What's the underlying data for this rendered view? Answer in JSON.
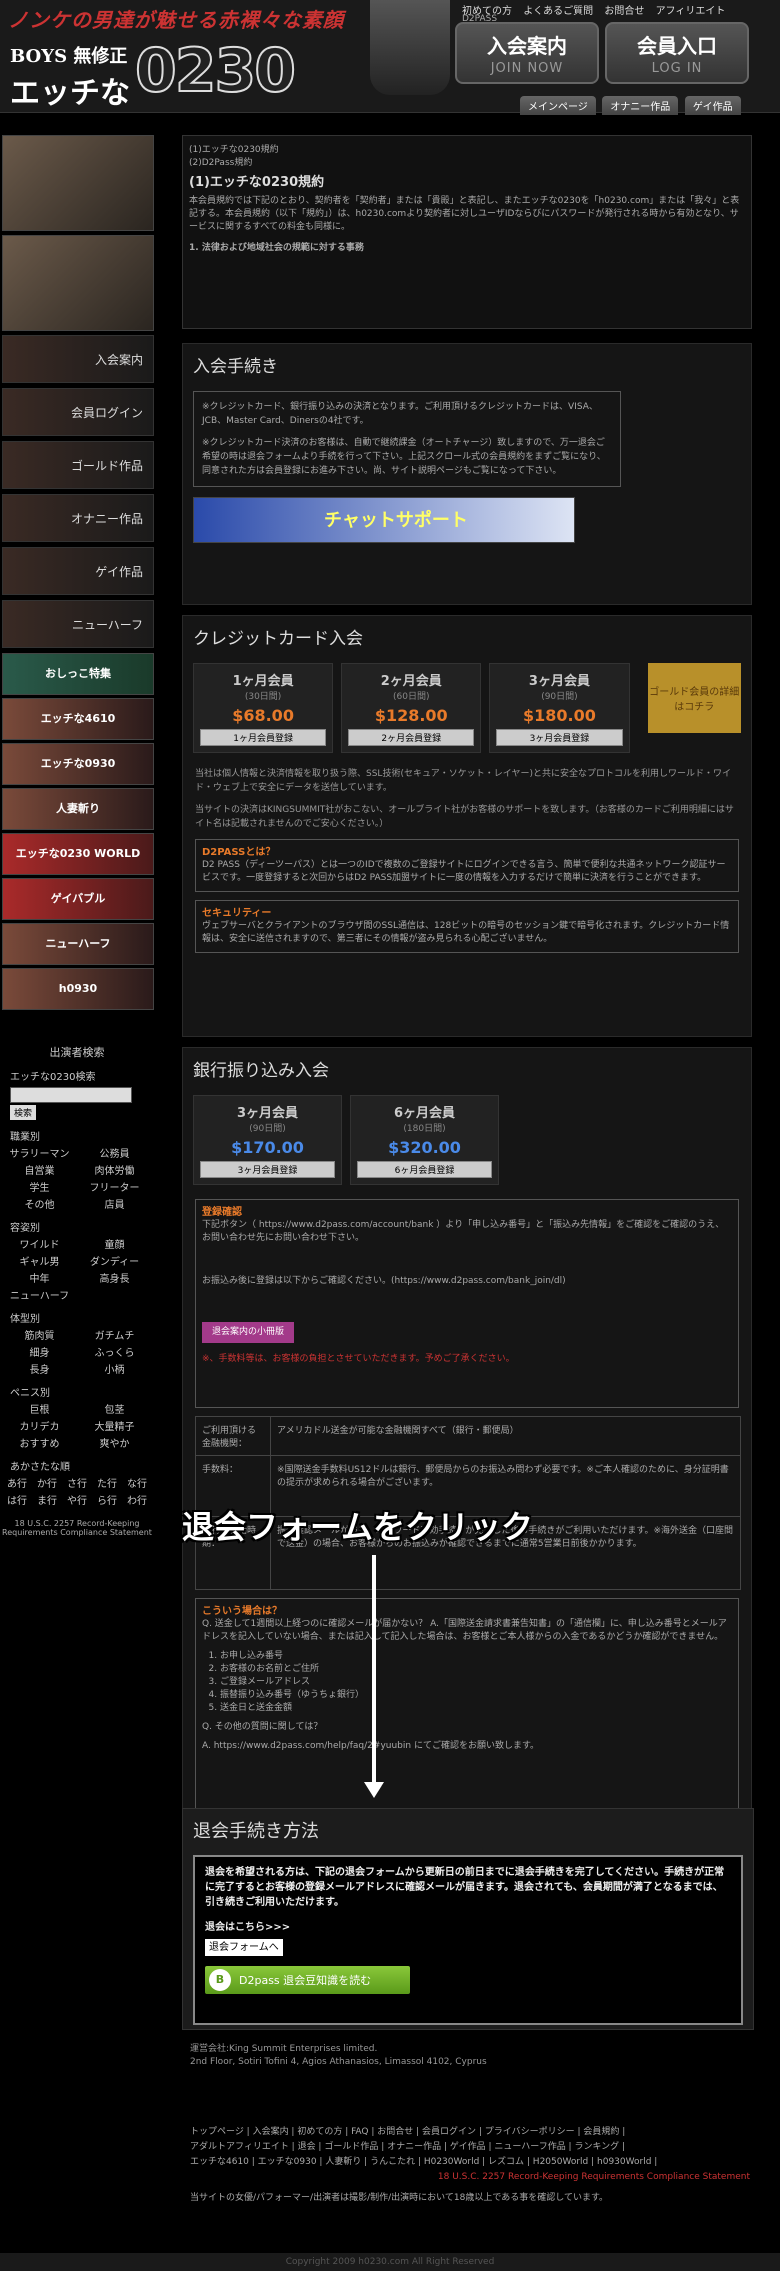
{
  "header": {
    "tagline": "ノンケの男達が魅せる赤裸々な素顔",
    "logo_sub": "BOYS 無修正",
    "logo_main": "エッチな",
    "logo_num": "0230",
    "top_links": [
      "初めての方",
      "よくあるご質問",
      "お問合せ",
      "アフィリエイト"
    ],
    "d2pass_label": "D2PASS",
    "join_label": "入会案内",
    "join_sub": "JOIN NOW",
    "login_label": "会員入口",
    "login_sub": "LOG IN",
    "tabs": [
      "メインページ",
      "オナニー作品",
      "ゲイ作品"
    ]
  },
  "sidebar": {
    "nav": [
      "入会案内",
      "会員ログイン",
      "ゴールド作品",
      "オナニー作品",
      "ゲイ作品",
      "ニューハーフ"
    ],
    "banners": [
      "おしっこ特集",
      "エッチな4610",
      "エッチな0930",
      "人妻斬り",
      "エッチな0230 WORLD",
      "ゲイバブル",
      "ニューハーフ",
      "h0930"
    ],
    "search_head": "出演者検索",
    "search_label": "エッチな0230検索",
    "search_button": "検索",
    "job_head": "職業別",
    "jobs": [
      [
        "サラリーマン",
        "公務員"
      ],
      [
        "自営業",
        "肉体労働"
      ],
      [
        "学生",
        "フリーター"
      ],
      [
        "その他",
        "店員"
      ]
    ],
    "type_head": "容姿別",
    "types": [
      [
        "ワイルド",
        "童顔"
      ],
      [
        "ギャル男",
        "ダンディー"
      ],
      [
        "中年",
        "高身長"
      ],
      [
        "ニューハーフ",
        ""
      ]
    ],
    "body_head": "体型別",
    "bodies": [
      [
        "筋肉質",
        "ガチムチ"
      ],
      [
        "細身",
        "ふっくら"
      ],
      [
        "長身",
        "小柄"
      ]
    ],
    "penis_head": "ペニス別",
    "penis": [
      [
        "巨根",
        "包茎"
      ],
      [
        "カリデカ",
        "大量精子"
      ],
      [
        "おすすめ",
        "爽やか"
      ]
    ],
    "kana_head": "あかさたな順",
    "kana": [
      [
        "あ行",
        "か行",
        "さ行",
        "た行",
        "な行"
      ],
      [
        "は行",
        "ま行",
        "や行",
        "ら行",
        "わ行"
      ]
    ],
    "legal": "18 U.S.C. 2257 Record-Keeping Requirements Compliance Statement"
  },
  "terms": {
    "line1": "(1)エッチな0230規約",
    "line2": "(2)D2Pass規約",
    "heading": "(1)エッチな0230規約",
    "body": "本会員規約では下記のとおり、契約者を「契約者」または「貴殿」と表記し、またエッチな0230を「h0230.com」または「我々」と表記する。本会員規約（以下「規約」）は、h0230.comより契約者に対しユーザIDならびにパスワードが発行される時から有効となり、サービスに関するすべての料金も同様に。",
    "section": "1. 法律および地域社会の規範に対する事務"
  },
  "join": {
    "title": "入会手続き",
    "box1": "※クレジットカード、銀行振り込みの決済となります。ご利用頂けるクレジットカードは、VISA、JCB、Master Card、Dinersの4社です。",
    "box2": "※クレジットカード決済のお客様は、自動で継続課金（オートチャージ）致しますので、万一退会ご希望の時は退会フォームより手続を行って下さい。上記スクロール式の会員規約をまずご覧になり、同意された方は会員登録にお進み下さい。尚、サイト説明ページもご覧になって下さい。",
    "chat_label": "チャットサポート"
  },
  "credit": {
    "title": "クレジットカード入会",
    "plans": [
      {
        "name": "1ヶ月会員",
        "days": "(30日間)",
        "price": "$68.00",
        "btn": "1ヶ月会員登録"
      },
      {
        "name": "2ヶ月会員",
        "days": "(60日間)",
        "price": "$128.00",
        "btn": "2ヶ月会員登録"
      },
      {
        "name": "3ヶ月会員",
        "days": "(90日間)",
        "price": "$180.00",
        "btn": "3ヶ月会員登録"
      }
    ],
    "gold": "ゴールド会員の詳細はコチラ",
    "note1": "当社は個人情報と決済情報を取り扱う際、SSL技術(セキュア・ソケット・レイヤー)と共に安全なプロトコルを利用しワールド・ワイド・ウェブ上で安全にデータを送信しています。",
    "note2": "当サイトの決済はKINGSUMMIT社がおこない、オールブライト社がお客様のサポートを致します。（お客様のカードご利用明細にはサイト名は記載されませんのでご安心ください。）",
    "d2_head": "D2PASSとは？",
    "d2_body": "D2 PASS（ディーツーパス）とは一つのIDで複数のご登録サイトにログインできる言う、簡単で便利な共通ネットワーク認証サービスです。一度登録すると次回からはD2 PASS加盟サイトに一度の情報を入力するだけで簡単に決済を行うことができます。",
    "sec_head": "セキュリティー",
    "sec_body": "ヴェブサーバとクライアントのブラウザ間のSSL通信は、128ビットの暗号のセッション鍵で暗号化されます。クレジットカード情報は、安全に送信されますので、第三者にその情報が盗み見られる心配ございません。"
  },
  "bank": {
    "title": "銀行振り込み入会",
    "plans": [
      {
        "name": "3ヶ月会員",
        "days": "(90日間)",
        "price": "$170.00",
        "btn": "3ヶ月会員登録"
      },
      {
        "name": "6ヶ月会員",
        "days": "(180日間)",
        "price": "$320.00",
        "btn": "6ヶ月会員登録"
      }
    ],
    "reg_head": "登録確認",
    "reg_body": "下記ボタン（ https://www.d2pass.com/account/bank ）より「申し込み番号」と「振込み先情報」をご確認をご確認のうえ、お問い合わせ先にお問い合わせ下さい。",
    "link_note": "お振込み後に登録は以下からご確認ください。(https://www.d2pass.com/bank_join/dl)",
    "small_btn": "退会案内の小冊版",
    "warn": "※、手数料等は、お客様の負担とさせていただきます。予めご了承ください。",
    "table": [
      [
        "ご利用頂ける金融機関：",
        "アメリカドル送金が可能な金融機関すべて（銀行・郵便局）"
      ],
      [
        "手数料：",
        "※国際送金手数料US12ドルは銀行、郵便局からのお振込み問わず必要です。※ご本人確認のために、身分証明書の提示が求められる場合がございます。"
      ],
      [
        "ご利用開始時期：",
        "振込確認メールが届き、パスワード有効手続きが完了した後お手続きがご利用いただけます。※海外送金（口座間で送金）の場合、お客様からのお振込みが確認できるまでに通常5営業日前後かかります。"
      ]
    ],
    "faq_q": "こういう場合は？",
    "faq_body": "Q. 送金して1週間以上経つのに確認メールが届かない？ A.「国際送金請求書兼告知書」の「通信欄」に、申し込み番号とメールアドレスを記入していない場合、または記入して記入した場合は、お客様とご本人様からの入金であるかどうか確認ができません。",
    "faq_list": [
      "お申し込み番号",
      "お客様のお名前とご住所",
      "ご登録メールアドレス",
      "振替振り込み番号（ゆうちょ銀行）",
      "送金日と送金金額"
    ],
    "faq_q2": "Q. その他の質問に関しては？",
    "faq_a2": "A. https://www.d2pass.com/help/faq/2#yuubin にてご確認をお願い致します。"
  },
  "annotation": "退会フォームをクリック",
  "withdraw": {
    "title": "退会手続き方法",
    "body": "退会を希望される方は、下記の退会フォームから更新日の前日までに退会手続きを完了してください。手続きが正常に完了するとお客様の登録メールアドレスに確認メールが届きます。退会されても、会員期間が満了となるまでは、引き続きご利用いただけます。",
    "here": "退会はこちら>>>",
    "form_link": "退会フォームへ",
    "d2_btn": "D2pass 退会豆知識を読む"
  },
  "company": {
    "line1": "運営会社:King Summit Enterprises limited.",
    "line2": "2nd Floor, Sotiri Tofini 4, Agios Athanasios, Limassol 4102, Cyprus"
  },
  "footer": {
    "line1": "トップページ | 入会案内 | 初めての方 | FAQ | お問合せ | 会員ログイン | プライバシーポリシー | 会員規約 |",
    "line2": "アダルトアフィリエイト | 退会 | ゴールド作品 | オナニー作品 | ゲイ作品 | ニューハーフ作品 | ランキング |",
    "line3": "エッチな4610 | エッチな0930 | 人妻斬り | うんこたれ | H0230World | レズコム | H2050World | h0930World |",
    "line4": "18 U.S.C. 2257 Record-Keeping Requirements Compliance Statement",
    "line5": "当サイトの女優/パフォーマー/出演者は撮影/制作/出演時において18歳以上である事を確認しています。",
    "copyright": "Copyright 2009 h0230.com All Right Reserved"
  }
}
